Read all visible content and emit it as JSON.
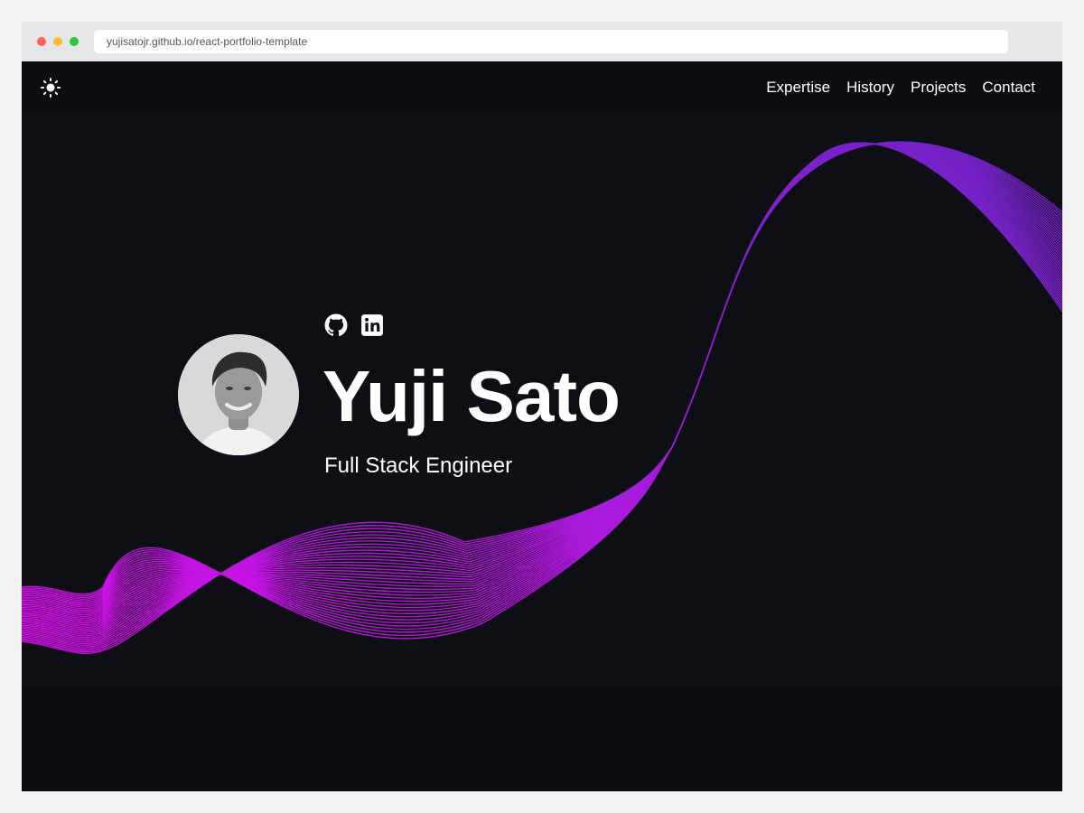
{
  "browser": {
    "url": "yujisatojr.github.io/react-portfolio-template"
  },
  "navbar": {
    "theme_icon": "sun-icon",
    "links": [
      {
        "label": "Expertise"
      },
      {
        "label": "History"
      },
      {
        "label": "Projects"
      },
      {
        "label": "Contact"
      }
    ]
  },
  "hero": {
    "name": "Yuji Sato",
    "role": "Full Stack Engineer",
    "socials": [
      {
        "icon": "github-icon"
      },
      {
        "icon": "linkedin-icon"
      }
    ],
    "avatar_icon": "profile-photo"
  },
  "colors": {
    "background": "#0d0f14",
    "accent_start": "#d30fe8",
    "accent_end": "#6e22c6",
    "text": "#ffffff"
  }
}
